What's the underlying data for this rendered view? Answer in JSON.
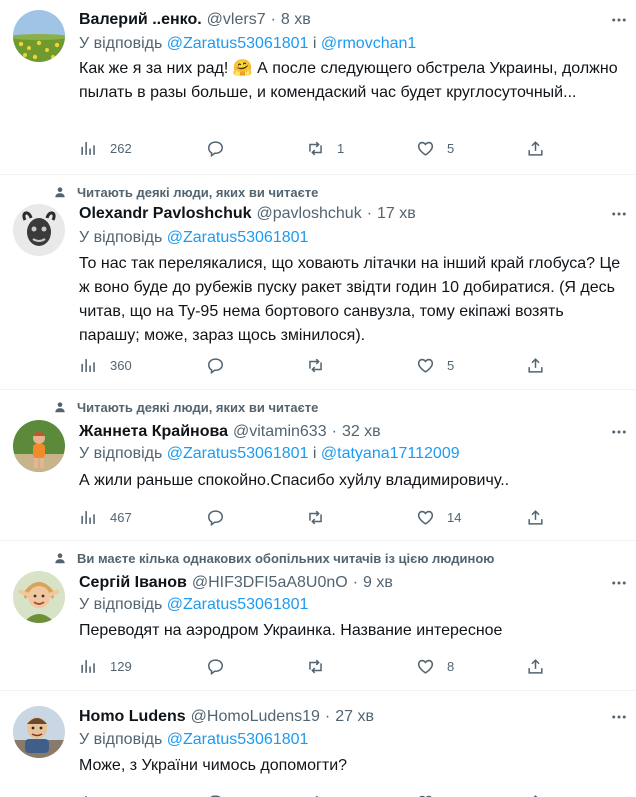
{
  "tweets": [
    {
      "social": "",
      "name": "Валерий ..енко.",
      "handle": "@vlers7",
      "time": "8 хв",
      "reply_prefix": "У відповідь",
      "mentions": [
        "@Zaratus53061801",
        "@rmovchan1"
      ],
      "mention_joiner": "і",
      "text": "Как же я за них рад! 🤗 А после следующего обстрела Украины, должно пылать в разы больше, и комендаский час будет круглосуточный...",
      "views": "262",
      "replies": "",
      "retweets": "1",
      "likes": "5",
      "avatar_icon": "field-landscape-avatar"
    },
    {
      "social": "Читають деякі люди, яких ви читаєте",
      "name": "Olexandr Pavloshchuk",
      "handle": "@pavloshchuk",
      "time": "17 хв",
      "reply_prefix": "У відповідь",
      "mentions": [
        "@Zaratus53061801"
      ],
      "mention_joiner": "",
      "text": "То нас так перелякалися, що ховають літачки на інший край глобуса? Це ж воно буде до рубежів пуску ракет звідти годин 10 добиратися. (Я десь читав, що на Ту-95 нема бортового санвузла, тому екіпажі возять парашу; може, зараз щось змінилося).",
      "views": "360",
      "replies": "",
      "retweets": "",
      "likes": "5",
      "avatar_icon": "horned-mask-avatar"
    },
    {
      "social": "Читають деякі люди, яких ви читаєте",
      "name": "Жаннета Крайнова",
      "handle": "@vitamin633",
      "time": "32 хв",
      "reply_prefix": "У відповідь",
      "mentions": [
        "@Zaratus53061801",
        "@tatyana17112009"
      ],
      "mention_joiner": "і",
      "text": "А жили раньше спокойно.Спасибо хуйлу владимировичу..",
      "views": "467",
      "replies": "",
      "retweets": "",
      "likes": "14",
      "avatar_icon": "person-outdoor-avatar"
    },
    {
      "social": "Ви маєте кілька однакових обопільних читачів із цією людиною",
      "name": "Сергій Іванов",
      "handle": "@HIF3DFI5aA8U0nO",
      "time": "9 хв",
      "reply_prefix": "У відповідь",
      "mentions": [
        "@Zaratus53061801"
      ],
      "mention_joiner": "",
      "text": "Переводят на аэродром Украинка. Название  интересное",
      "views": "129",
      "replies": "",
      "retweets": "",
      "likes": "8",
      "avatar_icon": "elf-portrait-avatar"
    },
    {
      "social": "",
      "name": "Homo Ludens",
      "handle": "@HomoLudens19",
      "time": "27 хв",
      "reply_prefix": "У відповідь",
      "mentions": [
        "@Zaratus53061801"
      ],
      "mention_joiner": "",
      "text": "Може, з України чимось допомогти?",
      "views": "",
      "replies": "",
      "retweets": "",
      "likes": "",
      "avatar_icon": "cartoon-man-avatar"
    }
  ],
  "colors": {
    "text": "#0f1419",
    "secondary": "#536471",
    "accent": "#1d9bf0",
    "divider": "#eff3f4"
  }
}
